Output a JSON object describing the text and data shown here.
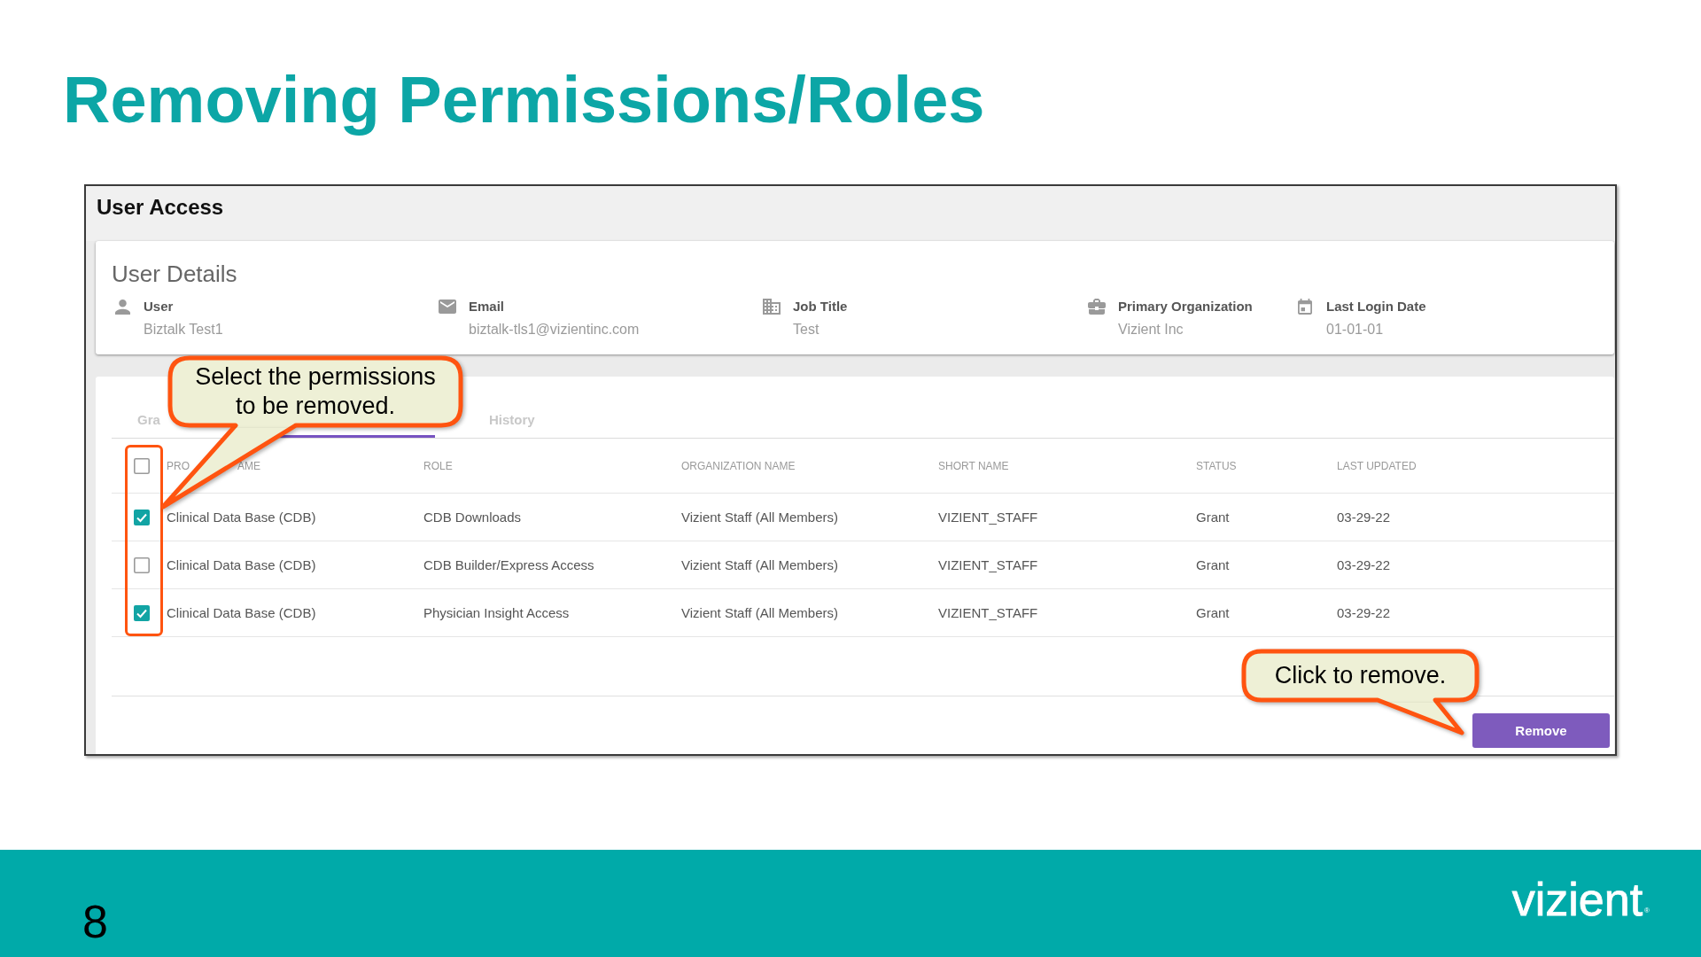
{
  "slide": {
    "title": "Removing Permissions/Roles"
  },
  "window": {
    "title": "User Access"
  },
  "user_details": {
    "title": "User Details",
    "fields": [
      {
        "kind": "user",
        "label": "User",
        "value": "Biztalk Test1"
      },
      {
        "kind": "email",
        "label": "Email",
        "value": "biztalk-tls1@vizientinc.com"
      },
      {
        "kind": "job",
        "label": "Job Title",
        "value": "Test"
      },
      {
        "kind": "organization",
        "label": "Primary Organization",
        "value": "Vizient Inc"
      },
      {
        "kind": "date",
        "label": "Last Login Date",
        "value": "01-01-01"
      }
    ]
  },
  "tabs": [
    {
      "label": "Gra",
      "selected": false
    },
    {
      "selected": true
    },
    {
      "label": "History",
      "selected": false
    }
  ],
  "table": {
    "select_all": {
      "checked": false
    },
    "columns": [
      {
        "label": "PRO",
        "label_tail": "AME"
      },
      {
        "label": "ROLE"
      },
      {
        "label": "ORGANIZATION NAME"
      },
      {
        "label": "SHORT NAME"
      },
      {
        "label": "STATUS"
      },
      {
        "label": "LAST UPDATED"
      }
    ],
    "rows": [
      {
        "checked": true,
        "cells": [
          "Clinical Data Base (CDB)",
          "CDB Downloads",
          "Vizient Staff (All Members)",
          "VIZIENT_STAFF",
          "Grant",
          "03-29-22"
        ]
      },
      {
        "checked": false,
        "cells": [
          "Clinical Data Base (CDB)",
          "CDB Builder/Express Access",
          "Vizient Staff (All Members)",
          "VIZIENT_STAFF",
          "Grant",
          "03-29-22"
        ]
      },
      {
        "checked": true,
        "cells": [
          "Clinical Data Base (CDB)",
          "Physician Insight Access",
          "Vizient Staff (All Members)",
          "VIZIENT_STAFF",
          "Grant",
          "03-29-22"
        ]
      }
    ]
  },
  "actions": {
    "remove_button": "Remove"
  },
  "callouts": [
    {
      "text": "Select the permissions to be removed."
    },
    {
      "text": "Click to remove."
    }
  ],
  "footer": {
    "page_number": "8",
    "logo": "vizient",
    "logo_mark": "®"
  }
}
